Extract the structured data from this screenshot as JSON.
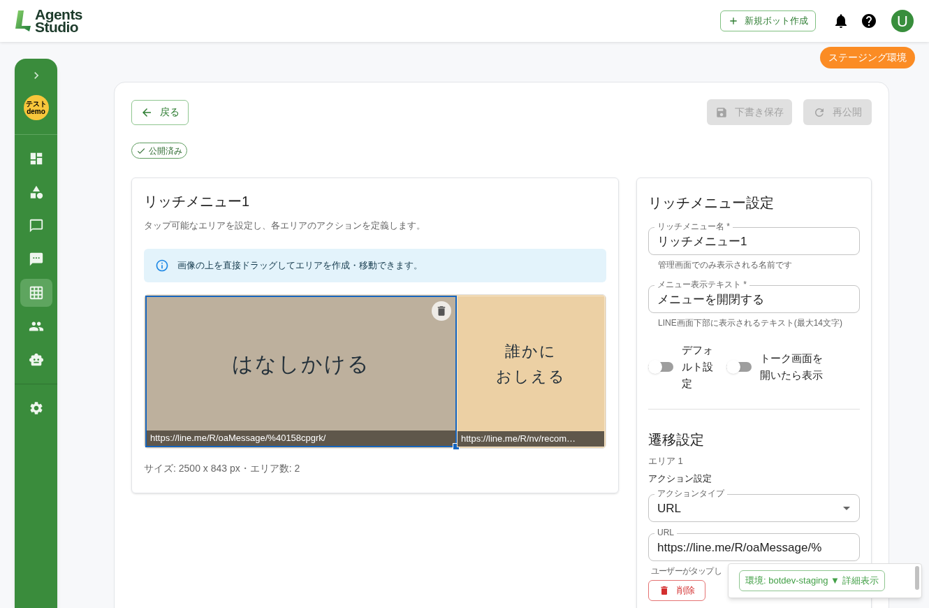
{
  "header": {
    "logo_line1": "Agents",
    "logo_line2": "Studio",
    "new_bot_button": "新規ボット作成",
    "avatar": "U"
  },
  "env_badge": "ステージング環境",
  "sidebar": {
    "org_badge_line1": "テスト",
    "org_badge_line2": "demo",
    "items": [
      {
        "kind": "dashboard",
        "selected": false
      },
      {
        "kind": "shapes",
        "selected": false
      },
      {
        "kind": "chat",
        "selected": false
      },
      {
        "kind": "sms",
        "selected": false
      },
      {
        "kind": "grid",
        "selected": true
      },
      {
        "kind": "people",
        "selected": false
      },
      {
        "kind": "bot",
        "selected": false
      },
      {
        "kind": "settings",
        "selected": false
      }
    ]
  },
  "toolbar": {
    "back": "戻る",
    "save_draft": {
      "label": "下書き保存",
      "disabled": true
    },
    "republish": {
      "label": "再公開",
      "disabled": true
    },
    "status": "公開済み"
  },
  "editor": {
    "title": "リッチメニュー1",
    "description": "タップ可能なエリアを設定し、各エリアのアクションを定義します。",
    "info": "画像の上を直接ドラッグしてエリアを作成・移動できます。",
    "areas": [
      {
        "lines": [
          "はなしかける"
        ],
        "url": "https://line.me/R/oaMessage/%40158cpgrk/",
        "selected": true
      },
      {
        "lines": [
          "誰かに",
          "おしえる"
        ],
        "url": "https://line.me/R/nv/recom…",
        "selected": false
      }
    ],
    "size_text": "サイズ: 2500 x 843 px・エリア数: 2"
  },
  "settings": {
    "title": "リッチメニュー設定",
    "fields": [
      {
        "label": "リッチメニュー名",
        "required_mark": "*",
        "value": "リッチメニュー1",
        "helper": "管理画面でのみ表示される名前です"
      },
      {
        "label": "メニュー表示テキスト",
        "required_mark": "*",
        "value": "メニューを開閉する",
        "helper": "LINE画面下部に表示されるテキスト(最大14文字)"
      }
    ],
    "toggles": [
      {
        "label": "デフォルト設定",
        "on": false
      },
      {
        "label": "トーク画面を開いたら表示",
        "on": false
      }
    ],
    "transition": {
      "title": "遷移設定",
      "area_label": "エリア 1",
      "action_heading": "アクション設定",
      "action_type": {
        "label": "アクションタイプ",
        "value": "URL"
      },
      "url": {
        "label": "URL",
        "value": "https://line.me/R/oaMessage/%",
        "helper": "ユーザーがタップし"
      },
      "delete_button": "削除"
    }
  },
  "env_panel": "環境: botdev-staging ▼ 詳細表示"
}
